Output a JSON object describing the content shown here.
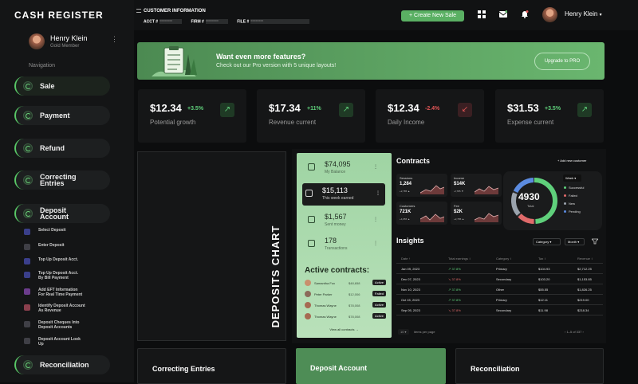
{
  "app": {
    "title": "CASH REGISTER"
  },
  "profile": {
    "name": "Henry Klein",
    "role": "Gold Member",
    "menu_icon": "⋮"
  },
  "nav": {
    "title": "Navigation",
    "items": [
      {
        "label": "Sale"
      },
      {
        "label": "Payment"
      },
      {
        "label": "Refund"
      },
      {
        "label": "Correcting\nEntries"
      },
      {
        "label": "Deposit\nAccount"
      },
      {
        "label": "Reconciliation"
      }
    ],
    "sub_items": [
      {
        "label": "Select Deposit",
        "color": "#3a3f8a"
      },
      {
        "label": "Enter Deposit",
        "color": "#3f3f46"
      },
      {
        "label": "Top Up Deposit Acct.",
        "color": "#3b3f8c"
      },
      {
        "label": "Top Up Deposit Acct.\nBy Bill Payment",
        "color": "#3a3f8a"
      },
      {
        "label": "Add EFT Information\nFor Real Time Payment",
        "color": "#6b3c8c"
      },
      {
        "label": "Identify Deposit Account\nAs Revenue",
        "color": "#8a3f4d"
      },
      {
        "label": "Deposit Cheques Into\nDeposit Accounts",
        "color": "#3f3f46"
      },
      {
        "label": "Deposit Account Look\nUp",
        "color": "#3f3f46"
      }
    ]
  },
  "topbar": {
    "customer_title": "CUSTOMER INFORMATION",
    "acct_label": "ACCT #",
    "firm_label": "FIRM #",
    "file_label": "FILE #",
    "acct_value": "XXXXXXXX",
    "firm_value": "XXXXXXXX",
    "file_value": "XXXXXXXX",
    "create_label": "+ Create New Sale",
    "user_name": "Henry Klein",
    "user_chevron": "▾"
  },
  "banner": {
    "title": "Want even more features?",
    "subtitle": "Check out our Pro version with 5 unique layouts!",
    "button": "Upgrade to PRO"
  },
  "stats": [
    {
      "value": "$12.34",
      "change": "+3.5%",
      "label": "Potential growth",
      "trend": "up",
      "arrow": "↗"
    },
    {
      "value": "$17.34",
      "change": "+11%",
      "label": "Revenue current",
      "trend": "up",
      "arrow": "↗"
    },
    {
      "value": "$12.34",
      "change": "-2.4%",
      "label": "Daily Income",
      "trend": "down",
      "arrow": "↙"
    },
    {
      "value": "$31.53",
      "change": "+3.5%",
      "label": "Expense current",
      "trend": "up",
      "arrow": "↗"
    }
  ],
  "deposits_chart": {
    "title": "DEPOSITS CHART"
  },
  "metrics": [
    {
      "value": "$74,095",
      "label": "My Balance",
      "icon": "bank-icon"
    },
    {
      "value": "$15,113",
      "label": "This week earned",
      "icon": "wallet-icon"
    },
    {
      "value": "$1,567",
      "label": "Sent money",
      "icon": "coins-icon"
    },
    {
      "value": "178",
      "label": "Transactions",
      "icon": "transactions-icon"
    }
  ],
  "active_contracts": {
    "title": "Active contracts:",
    "rows": [
      {
        "name": "Samantha Fox",
        "amount": "$48,658",
        "status": "Active",
        "color": "#c98f6d"
      },
      {
        "name": "Peter Parker",
        "amount": "$12,006",
        "status": "Failed",
        "color": "#8b6b5a"
      },
      {
        "name": "Thomas Wayne",
        "amount": "$78,008",
        "status": "Active",
        "color": "#a66a52"
      },
      {
        "name": "Thomas Wayne",
        "amount": "$78,008",
        "status": "Active",
        "color": "#a66a52"
      }
    ],
    "view_all": "View all contracts →"
  },
  "contracts": {
    "title": "Contracts",
    "add_button": "+ Add new customer",
    "minis": [
      {
        "label": "Sessions",
        "value": "1,284",
        "change": "+2,785 ▲"
      },
      {
        "label": "Income",
        "value": "$14K",
        "change": "-2,785 ▼"
      },
      {
        "label": "Customers",
        "value": "721K",
        "change": "+4,655 ▲"
      },
      {
        "label": "Fee",
        "value": "$2K",
        "change": "+2,785 ▲"
      }
    ],
    "donut": {
      "value": "4930",
      "label": "Total",
      "period": "Week ▾"
    },
    "legend": [
      {
        "label": "Successful",
        "color": "#5fd07b"
      },
      {
        "label": "Failed",
        "color": "#e06a6a"
      },
      {
        "label": "New",
        "color": "#9aa3ad"
      },
      {
        "label": "Pending",
        "color": "#5b8be0"
      }
    ]
  },
  "insights": {
    "title": "Insights",
    "filter_category": "Category ▾",
    "filter_period": "Month ▾",
    "filter_icon": "filter-icon",
    "columns": [
      "Date ↑",
      "Total earnings ↕",
      "Category ↕",
      "Tax ↕",
      "Revenue ↕"
    ],
    "rows": [
      {
        "date": "Jan 09, 2023",
        "earn": "↗ 37.8%",
        "cat": "Primary",
        "tax": "$104.93",
        "rev": "$2,712.25",
        "up": true
      },
      {
        "date": "Dec 07, 2023",
        "earn": "↘ 37.8%",
        "cat": "Secondary",
        "tax": "$103.20",
        "rev": "$1,153.85",
        "up": false
      },
      {
        "date": "Nov 10, 2023",
        "earn": "↗ 37.8%",
        "cat": "Other",
        "tax": "$55.55",
        "rev": "$1,826.25",
        "up": true
      },
      {
        "date": "Oct 15, 2023",
        "earn": "↗ 37.8%",
        "cat": "Primary",
        "tax": "$12.11",
        "rev": "$219.00",
        "up": true
      },
      {
        "date": "Sep 05, 2023",
        "earn": "↘ 37.8%",
        "cat": "Secondary",
        "tax": "$11.98",
        "rev": "$218.34",
        "up": false
      }
    ],
    "page_size": "10 ▾",
    "page_size_label": "items per page",
    "pagination": "‹  1–5 of 337  ›"
  },
  "bottom": [
    {
      "label": "Correcting Entries"
    },
    {
      "label": "Deposit Account"
    },
    {
      "label": "Reconciliation"
    }
  ]
}
